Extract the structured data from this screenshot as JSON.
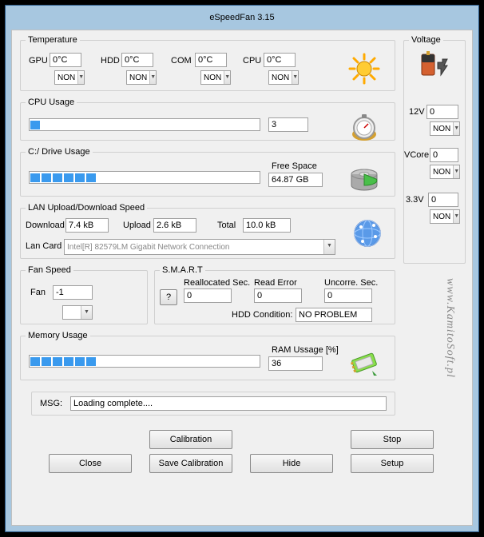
{
  "title": "eSpeedFan 3.15",
  "temperature": {
    "legend": "Temperature",
    "gpu_label": "GPU",
    "gpu_value": "0°C",
    "gpu_mode": "NON",
    "hdd_label": "HDD",
    "hdd_value": "0°C",
    "hdd_mode": "NON",
    "com_label": "COM",
    "com_value": "0°C",
    "com_mode": "NON",
    "cpu_label": "CPU",
    "cpu_value": "0°C",
    "cpu_mode": "NON"
  },
  "cpu_usage": {
    "legend": "CPU Usage",
    "value": "3",
    "segments": 1
  },
  "drive_usage": {
    "legend": "C:/ Drive Usage",
    "free_label": "Free Space",
    "free_value": "64.87 GB",
    "segments": 6
  },
  "lan": {
    "legend": "LAN Upload/Download Speed",
    "download_label": "Download",
    "download_value": "7.4 kB",
    "upload_label": "Upload",
    "upload_value": "2.6 kB",
    "total_label": "Total",
    "total_value": "10.0 kB",
    "lan_card_label": "Lan Card",
    "lan_card_value": "Intel[R] 82579LM Gigabit Network Connection"
  },
  "fan_speed": {
    "legend": "Fan Speed",
    "fan_label": "Fan",
    "fan_value": "-1",
    "mode": ""
  },
  "smart": {
    "legend": "S.M.A.R.T",
    "realloc_label": "Reallocated Sec.",
    "realloc_value": "0",
    "read_error_label": "Read Error",
    "read_error_value": "0",
    "uncorr_label": "Uncorre. Sec.",
    "uncorr_value": "0",
    "condition_label": "HDD Condition:",
    "condition_value": "NO PROBLEM",
    "q": "?"
  },
  "memory": {
    "legend": "Memory Usage",
    "ram_label": "RAM Ussage [%]",
    "ram_value": "36",
    "segments": 6
  },
  "msg": {
    "label": "MSG:",
    "value": "Loading complete...."
  },
  "buttons": {
    "calibration": "Calibration",
    "save_calibration": "Save Calibration",
    "hide": "Hide",
    "stop": "Stop",
    "setup": "Setup",
    "close": "Close"
  },
  "voltage": {
    "legend": "Voltage",
    "v12_label": "12V",
    "v12_value": "0",
    "v12_mode": "NON",
    "vcore_label": "VCore",
    "vcore_value": "0",
    "vcore_mode": "NON",
    "v33_label": "3.3V",
    "v33_value": "0",
    "v33_mode": "NON"
  },
  "branding": "www.KamitoSoft.pl"
}
